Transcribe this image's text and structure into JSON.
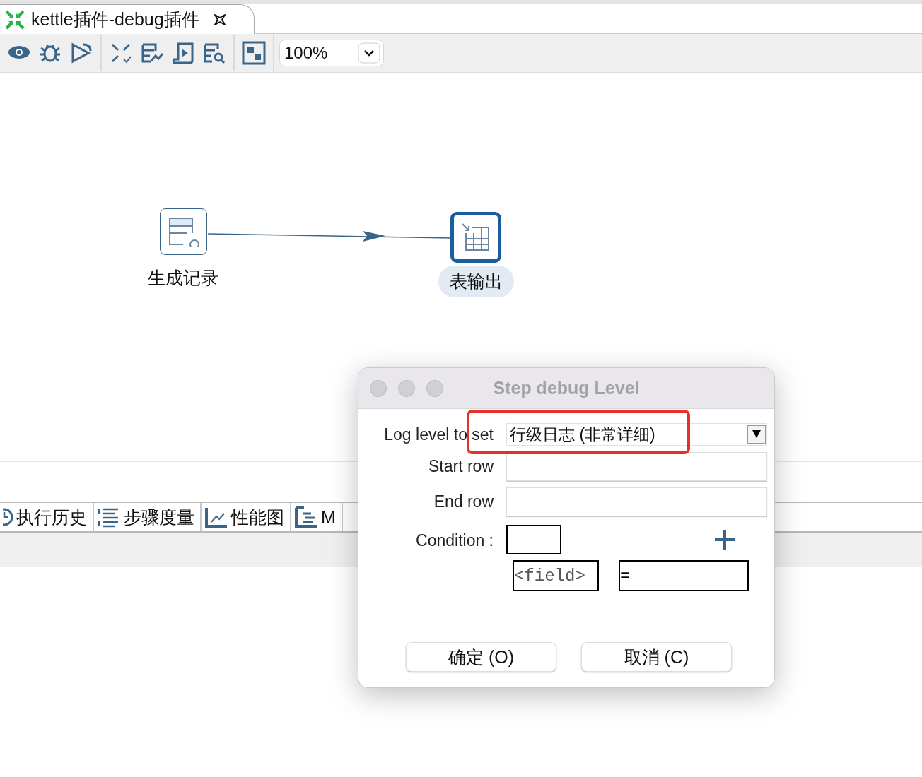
{
  "tab": {
    "title": "kettle插件-debug插件",
    "selected": true
  },
  "toolbar": {
    "zoom": "100%"
  },
  "canvas": {
    "steps": [
      {
        "label": "生成记录",
        "kind": "generator",
        "selected": false
      },
      {
        "label": "表输出",
        "kind": "table-output",
        "selected": true
      }
    ]
  },
  "bottom_panel": {
    "tabs": [
      {
        "label": "执行历史",
        "kind": "history"
      },
      {
        "label": "步骤度量",
        "kind": "metrics"
      },
      {
        "label": "性能图",
        "kind": "chart"
      },
      {
        "label": "M",
        "kind": "tree"
      }
    ]
  },
  "dialog": {
    "title": "Step debug Level",
    "log_level": {
      "label": "Log level to set",
      "value": "行级日志 (非常详细)",
      "highlighted": true
    },
    "start_row": {
      "label": "Start row"
    },
    "end_row": {
      "label": "End row"
    },
    "condition": {
      "label": "Condition :",
      "field": "<field>",
      "operator": "="
    },
    "buttons": [
      "确定 (O)",
      "取消 (C)"
    ]
  }
}
